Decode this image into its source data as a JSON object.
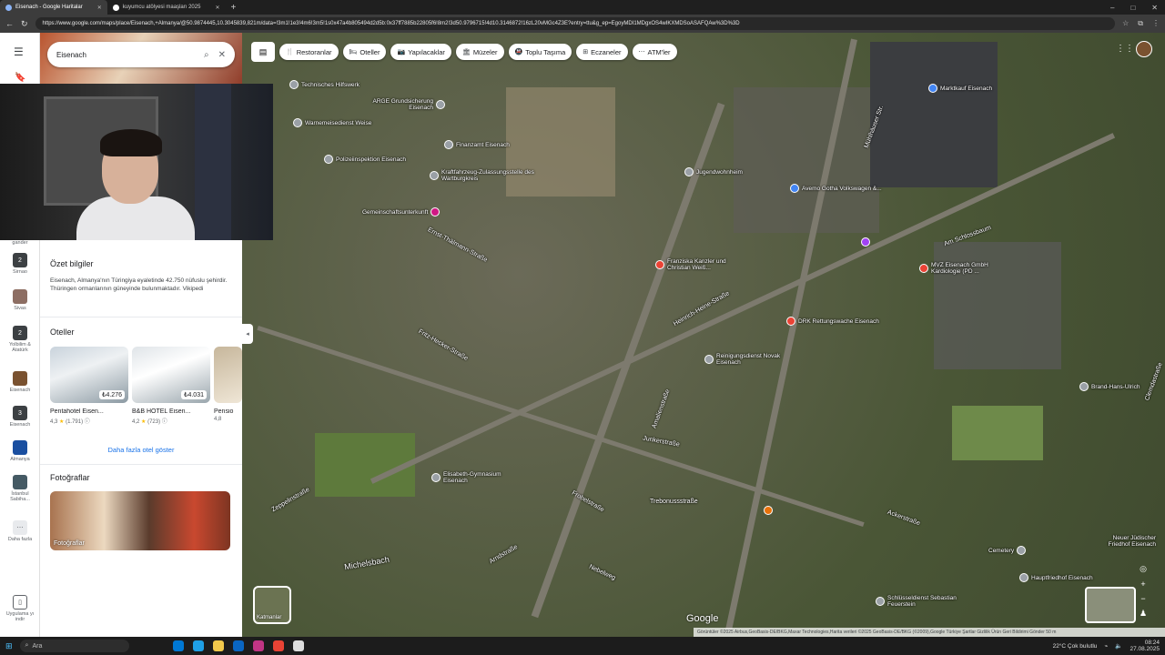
{
  "browser": {
    "tabs": [
      {
        "label": "Eisenach - Google Haritalar",
        "active": true
      },
      {
        "label": "kuyumcu atölyesi maaşları 2025",
        "active": false
      }
    ],
    "new_tab": "+",
    "url": "https://www.google.com/maps/place/Eisenach,+Almanya/@50.9874445,10.3045839,821m/data=!3m1!1e3!4m6!3m5!1s0x47a4b805494d2d5b:0x37ff7885b22805f6!8m2!3d50.9796715!4d10.3146872!16zL20vMGc4Z3E?entry=ttu&g_ep=EgoyMDI1MDgxOS4wIKXMDSoASAFQAw%3D%3D",
    "controls": {
      "minimize": "–",
      "maximize": "□",
      "close": "✕"
    }
  },
  "search": {
    "value": "Eisenach"
  },
  "chips": [
    {
      "icon": "restaurant-icon",
      "label": "Restoranlar"
    },
    {
      "icon": "hotel-icon",
      "label": "Oteller"
    },
    {
      "icon": "activities-icon",
      "label": "Yapılacaklar"
    },
    {
      "icon": "museum-icon",
      "label": "Müzeler"
    },
    {
      "icon": "transit-icon",
      "label": "Toplu Taşıma"
    },
    {
      "icon": "pharmacy-icon",
      "label": "Eczaneler"
    },
    {
      "icon": "atm-icon",
      "label": "ATM'ler"
    }
  ],
  "rail": [
    {
      "label": "gander"
    },
    {
      "label": "Sirnao"
    },
    {
      "label": "Sivas"
    },
    {
      "label": "Yolbilim & Atatürk"
    },
    {
      "label": "Eisenach"
    },
    {
      "label": "Eisenach"
    },
    {
      "label": "Almanya"
    },
    {
      "label": "İstanbul Sabiha..."
    },
    {
      "label": "Daha fazla"
    },
    {
      "label": "Uygulama yı indir"
    }
  ],
  "summary": {
    "title": "Özet bilgiler",
    "text": "Eisenach, Almanya'nın Türingiya eyaletinde 42.750 nüfuslu şehirdir. Thüringen ormanlarının güneyinde bulunmaktadır.",
    "source": "Vikipedi"
  },
  "hotels": {
    "title": "Oteller",
    "items": [
      {
        "name": "Pentahotel Eisen...",
        "price": "₺4.276",
        "rating": "4,3",
        "reviews": "(1.791)"
      },
      {
        "name": "B&B HOTEL Eisen...",
        "price": "₺4.031",
        "rating": "4,2",
        "reviews": "(723)"
      },
      {
        "name": "Pensio",
        "price": "",
        "rating": "4,8",
        "reviews": ""
      }
    ],
    "more_label": "Daha fazla otel göster"
  },
  "photos": {
    "title": "Fotoğraflar",
    "label": "Fotoğraflar"
  },
  "map": {
    "pois": [
      {
        "label": "Technisches Hilfswerk",
        "color": "gray"
      },
      {
        "label": "ARGE Grundsicherung Eisenach",
        "color": "gray"
      },
      {
        "label": "Warnemeisedienst Weise",
        "color": "gray"
      },
      {
        "label": "Polizeiinspektion Eisenach",
        "color": "gray"
      },
      {
        "label": "Finanzamt Eisenach",
        "color": "gray"
      },
      {
        "label": "Kraftfahrzeug-Zulassungsstelle des Wartburgkreis",
        "color": "gray"
      },
      {
        "label": "Gemeinschaftsunterkunft",
        "color": "pink"
      },
      {
        "label": "Franziska Kanzler und Christian Weiß...",
        "color": "red"
      },
      {
        "label": "Jugendwohnheim",
        "color": "gray"
      },
      {
        "label": "Avemo Gotha Volkswagen &...",
        "color": "blue"
      },
      {
        "label": "Marktkauf Eisenach",
        "color": "blue"
      },
      {
        "label": "MVZ Eisenach GmbH Kardiologie (PD ...",
        "color": "red"
      },
      {
        "label": "DRK Rettungswache Eisenach",
        "color": "red"
      },
      {
        "label": "Reinigungsdienst Novak Eisenach",
        "color": "gray"
      },
      {
        "label": "Elisabeth-Gymnasium Eisenach",
        "color": "gray"
      },
      {
        "label": "Brand-Hans-Ulrich",
        "color": "gray"
      },
      {
        "label": "Cemetery",
        "color": "gray"
      },
      {
        "label": "Hauptfriedhof Eisenach",
        "color": "gray"
      },
      {
        "label": "Schlüsseldienst Sebastian Feuerstein",
        "color": "gray"
      },
      {
        "label": "Michelsbach",
        "color": "gray"
      },
      {
        "label": "Neuer Jüdischer Friedhof Eisenach",
        "color": "gray"
      }
    ],
    "streets": [
      {
        "label": "Ernst-Thälmann-Straße"
      },
      {
        "label": "Fritz-Hecker-Straße"
      },
      {
        "label": "Heinrich-Heine-Straße"
      },
      {
        "label": "Mühlhäuser Str."
      },
      {
        "label": "Junkerstraße"
      },
      {
        "label": "Trebonussstraße"
      },
      {
        "label": "Zeppelinstraße"
      },
      {
        "label": "Frobelstraße"
      },
      {
        "label": "Nebelweg"
      },
      {
        "label": "Arndstraße"
      },
      {
        "label": "Am Schlossbaum"
      },
      {
        "label": "Ackerstraße"
      },
      {
        "label": "Amalienstraße"
      },
      {
        "label": "Clemdastraße"
      }
    ],
    "layers_label": "Katmanlar",
    "google": "Google",
    "attribution": "Görüntüler ©2025 Airbus,GeoBasis-DE/BKG,Maxar Technologies,Harita verileri ©2025 GeoBasis-DE/BKG (©2009),Google   Türkiye   Şartlar   Gizlilik   Ürün Geri Bildirimi Gönder   50 m"
  },
  "taskbar": {
    "search": "Ara",
    "weather": "22°C  Çok bulutlu",
    "time": "08:24",
    "date": "27.08.2025"
  }
}
